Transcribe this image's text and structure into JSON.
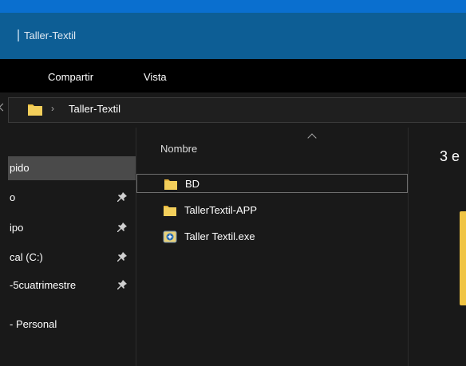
{
  "window": {
    "title": "Taller-Textil"
  },
  "ribbon": {
    "tabs": [
      {
        "label": "Compartir"
      },
      {
        "label": "Vista"
      }
    ]
  },
  "address": {
    "path": "Taller-Textil",
    "separator": "›"
  },
  "nav": {
    "items": [
      {
        "label": "pido",
        "pinned": false,
        "selected": true
      },
      {
        "label": "o",
        "pinned": true,
        "selected": false
      },
      {
        "label": "ipo",
        "pinned": true,
        "selected": false
      },
      {
        "label": "cal (C:)",
        "pinned": true,
        "selected": false
      },
      {
        "label": "-5cuatrimestre",
        "pinned": true,
        "selected": false
      },
      {
        "label": "- Personal",
        "pinned": false,
        "selected": false
      }
    ]
  },
  "list": {
    "column_header": "Nombre",
    "files": [
      {
        "name": "BD",
        "icon": "folder-icon",
        "selected": true
      },
      {
        "name": "TallerTextil-APP",
        "icon": "folder-icon",
        "selected": false
      },
      {
        "name": "Taller Textil.exe",
        "icon": "exe-icon",
        "selected": false
      }
    ]
  },
  "details": {
    "text": "3 e"
  },
  "colors": {
    "titlebar": "#0d5e95",
    "accent": "#0a6fcf",
    "folder": "#f0c443",
    "background": "#191919"
  }
}
